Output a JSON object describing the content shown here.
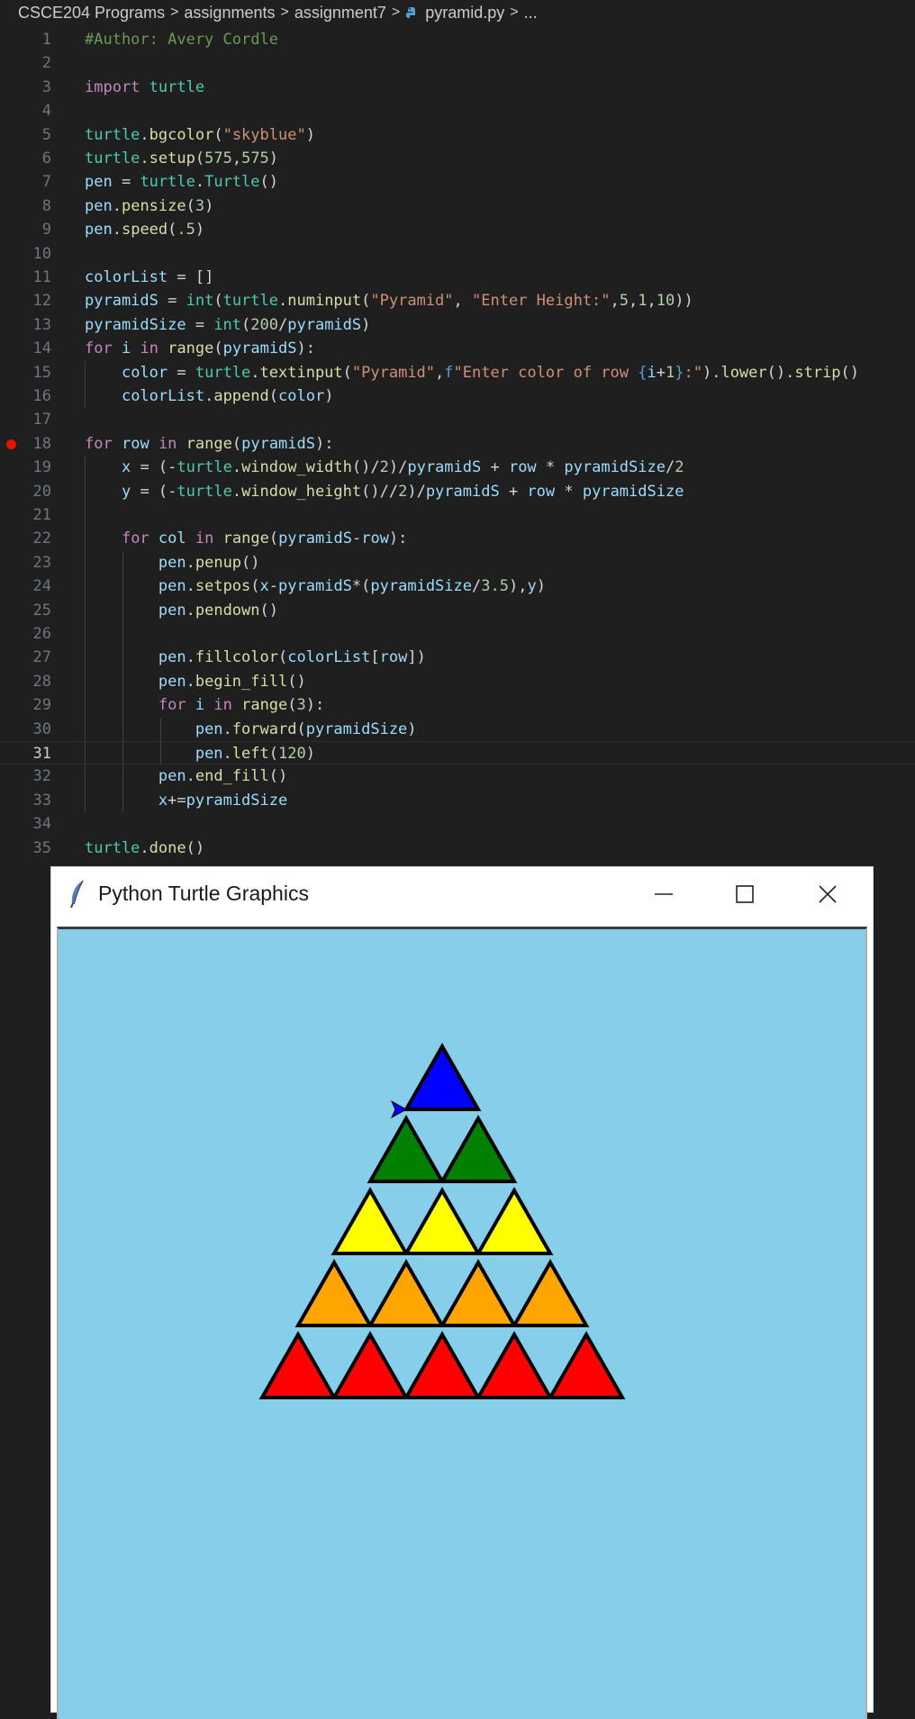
{
  "breadcrumb": {
    "items": [
      "CSCE204 Programs",
      "assignments",
      "assignment7",
      "pyramid.py",
      "..."
    ],
    "separator": ">"
  },
  "editor": {
    "current_line": 31,
    "breakpoint_line": 18,
    "lines": [
      {
        "n": "1",
        "tokens": [
          [
            "c",
            "#Author: Avery Cordle"
          ]
        ]
      },
      {
        "n": "2",
        "tokens": []
      },
      {
        "n": "3",
        "tokens": [
          [
            "k",
            "import"
          ],
          [
            "",
            " "
          ],
          [
            "b",
            "turtle"
          ]
        ]
      },
      {
        "n": "4",
        "tokens": []
      },
      {
        "n": "5",
        "tokens": [
          [
            "b",
            "turtle"
          ],
          [
            "",
            "."
          ],
          [
            "f",
            "bgcolor"
          ],
          [
            "",
            "("
          ],
          [
            "s",
            "\"skyblue\""
          ],
          [
            "",
            ")"
          ]
        ]
      },
      {
        "n": "6",
        "tokens": [
          [
            "b",
            "turtle"
          ],
          [
            "",
            "."
          ],
          [
            "f",
            "setup"
          ],
          [
            "",
            "("
          ],
          [
            "n",
            "575"
          ],
          [
            "",
            ","
          ],
          [
            "n",
            "575"
          ],
          [
            "",
            ")"
          ]
        ]
      },
      {
        "n": "7",
        "tokens": [
          [
            "v",
            "pen"
          ],
          [
            "",
            " = "
          ],
          [
            "b",
            "turtle"
          ],
          [
            "",
            "."
          ],
          [
            "b",
            "Turtle"
          ],
          [
            "",
            "()"
          ]
        ]
      },
      {
        "n": "8",
        "tokens": [
          [
            "v",
            "pen"
          ],
          [
            "",
            "."
          ],
          [
            "f",
            "pensize"
          ],
          [
            "",
            "("
          ],
          [
            "n",
            "3"
          ],
          [
            "",
            ")"
          ]
        ]
      },
      {
        "n": "9",
        "tokens": [
          [
            "v",
            "pen"
          ],
          [
            "",
            "."
          ],
          [
            "f",
            "speed"
          ],
          [
            "",
            "("
          ],
          [
            "n",
            ".5"
          ],
          [
            "",
            ")"
          ]
        ]
      },
      {
        "n": "10",
        "tokens": []
      },
      {
        "n": "11",
        "tokens": [
          [
            "v",
            "colorList"
          ],
          [
            "",
            " = []"
          ]
        ]
      },
      {
        "n": "12",
        "tokens": [
          [
            "v",
            "pyramidS"
          ],
          [
            "",
            " = "
          ],
          [
            "b",
            "int"
          ],
          [
            "",
            "("
          ],
          [
            "b",
            "turtle"
          ],
          [
            "",
            "."
          ],
          [
            "f",
            "numinput"
          ],
          [
            "",
            "("
          ],
          [
            "s",
            "\"Pyramid\""
          ],
          [
            "",
            ", "
          ],
          [
            "s",
            "\"Enter Height:\""
          ],
          [
            "",
            ","
          ],
          [
            "n",
            "5"
          ],
          [
            "",
            ","
          ],
          [
            "n",
            "1"
          ],
          [
            "",
            ","
          ],
          [
            "n",
            "10"
          ],
          [
            "",
            "))"
          ]
        ]
      },
      {
        "n": "13",
        "tokens": [
          [
            "v",
            "pyramidSize"
          ],
          [
            "",
            " = "
          ],
          [
            "b",
            "int"
          ],
          [
            "",
            "("
          ],
          [
            "n",
            "200"
          ],
          [
            "",
            "/"
          ],
          [
            "v",
            "pyramidS"
          ],
          [
            "",
            ")"
          ]
        ]
      },
      {
        "n": "14",
        "tokens": [
          [
            "k",
            "for"
          ],
          [
            "",
            " "
          ],
          [
            "v",
            "i"
          ],
          [
            "",
            " "
          ],
          [
            "k",
            "in"
          ],
          [
            "",
            " "
          ],
          [
            "f",
            "range"
          ],
          [
            "",
            "("
          ],
          [
            "v",
            "pyramidS"
          ],
          [
            "",
            "):"
          ]
        ]
      },
      {
        "n": "15",
        "tokens": [
          [
            "",
            "    "
          ],
          [
            "v",
            "color"
          ],
          [
            "",
            " = "
          ],
          [
            "b",
            "turtle"
          ],
          [
            "",
            "."
          ],
          [
            "f",
            "textinput"
          ],
          [
            "",
            "("
          ],
          [
            "s",
            "\"Pyramid\""
          ],
          [
            "",
            ","
          ],
          [
            "fs",
            "f"
          ],
          [
            "s",
            "\"Enter color of row "
          ],
          [
            "fs",
            "{"
          ],
          [
            "v",
            "i"
          ],
          [
            "",
            "+"
          ],
          [
            "n",
            "1"
          ],
          [
            "fs",
            "}"
          ],
          [
            "s",
            ":\""
          ],
          [
            "",
            ")."
          ],
          [
            "f",
            "lower"
          ],
          [
            "",
            "()."
          ],
          [
            "f",
            "strip"
          ],
          [
            "",
            "()"
          ]
        ]
      },
      {
        "n": "16",
        "tokens": [
          [
            "",
            "    "
          ],
          [
            "v",
            "colorList"
          ],
          [
            "",
            "."
          ],
          [
            "f",
            "append"
          ],
          [
            "",
            "("
          ],
          [
            "v",
            "color"
          ],
          [
            "",
            ")"
          ]
        ]
      },
      {
        "n": "17",
        "tokens": []
      },
      {
        "n": "18",
        "tokens": [
          [
            "k",
            "for"
          ],
          [
            "",
            " "
          ],
          [
            "v",
            "row"
          ],
          [
            "",
            " "
          ],
          [
            "k",
            "in"
          ],
          [
            "",
            " "
          ],
          [
            "f",
            "range"
          ],
          [
            "",
            "("
          ],
          [
            "v",
            "pyramidS"
          ],
          [
            "",
            "):"
          ]
        ]
      },
      {
        "n": "19",
        "tokens": [
          [
            "",
            "    "
          ],
          [
            "v",
            "x"
          ],
          [
            "",
            " = (-"
          ],
          [
            "b",
            "turtle"
          ],
          [
            "",
            "."
          ],
          [
            "f",
            "window_width"
          ],
          [
            "",
            "()/"
          ],
          [
            "n",
            "2"
          ],
          [
            "",
            ")/"
          ],
          [
            "v",
            "pyramidS"
          ],
          [
            "",
            " + "
          ],
          [
            "v",
            "row"
          ],
          [
            "",
            " * "
          ],
          [
            "v",
            "pyramidSize"
          ],
          [
            "",
            "/"
          ],
          [
            "n",
            "2"
          ]
        ]
      },
      {
        "n": "20",
        "tokens": [
          [
            "",
            "    "
          ],
          [
            "v",
            "y"
          ],
          [
            "",
            " = (-"
          ],
          [
            "b",
            "turtle"
          ],
          [
            "",
            "."
          ],
          [
            "f",
            "window_height"
          ],
          [
            "",
            "()//"
          ],
          [
            "n",
            "2"
          ],
          [
            "",
            ")/"
          ],
          [
            "v",
            "pyramidS"
          ],
          [
            "",
            " + "
          ],
          [
            "v",
            "row"
          ],
          [
            "",
            " * "
          ],
          [
            "v",
            "pyramidSize"
          ]
        ]
      },
      {
        "n": "21",
        "tokens": []
      },
      {
        "n": "22",
        "tokens": [
          [
            "",
            "    "
          ],
          [
            "k",
            "for"
          ],
          [
            "",
            " "
          ],
          [
            "v",
            "col"
          ],
          [
            "",
            " "
          ],
          [
            "k",
            "in"
          ],
          [
            "",
            " "
          ],
          [
            "f",
            "range"
          ],
          [
            "",
            "("
          ],
          [
            "v",
            "pyramidS"
          ],
          [
            "",
            "-"
          ],
          [
            "v",
            "row"
          ],
          [
            "",
            "):"
          ]
        ]
      },
      {
        "n": "23",
        "tokens": [
          [
            "",
            "        "
          ],
          [
            "v",
            "pen"
          ],
          [
            "",
            "."
          ],
          [
            "f",
            "penup"
          ],
          [
            "",
            "()"
          ]
        ]
      },
      {
        "n": "24",
        "tokens": [
          [
            "",
            "        "
          ],
          [
            "v",
            "pen"
          ],
          [
            "",
            "."
          ],
          [
            "f",
            "setpos"
          ],
          [
            "",
            "("
          ],
          [
            "v",
            "x"
          ],
          [
            "",
            "-"
          ],
          [
            "v",
            "pyramidS"
          ],
          [
            "",
            "*("
          ],
          [
            "v",
            "pyramidSize"
          ],
          [
            "",
            "/"
          ],
          [
            "n",
            "3.5"
          ],
          [
            "",
            "),"
          ],
          [
            "v",
            "y"
          ],
          [
            "",
            ")"
          ]
        ]
      },
      {
        "n": "25",
        "tokens": [
          [
            "",
            "        "
          ],
          [
            "v",
            "pen"
          ],
          [
            "",
            "."
          ],
          [
            "f",
            "pendown"
          ],
          [
            "",
            "()"
          ]
        ]
      },
      {
        "n": "26",
        "tokens": []
      },
      {
        "n": "27",
        "tokens": [
          [
            "",
            "        "
          ],
          [
            "v",
            "pen"
          ],
          [
            "",
            "."
          ],
          [
            "f",
            "fillcolor"
          ],
          [
            "",
            "("
          ],
          [
            "v",
            "colorList"
          ],
          [
            "",
            "["
          ],
          [
            "v",
            "row"
          ],
          [
            "",
            "])"
          ]
        ]
      },
      {
        "n": "28",
        "tokens": [
          [
            "",
            "        "
          ],
          [
            "v",
            "pen"
          ],
          [
            "",
            "."
          ],
          [
            "f",
            "begin_fill"
          ],
          [
            "",
            "()"
          ]
        ]
      },
      {
        "n": "29",
        "tokens": [
          [
            "",
            "        "
          ],
          [
            "k",
            "for"
          ],
          [
            "",
            " "
          ],
          [
            "v",
            "i"
          ],
          [
            "",
            " "
          ],
          [
            "k",
            "in"
          ],
          [
            "",
            " "
          ],
          [
            "f",
            "range"
          ],
          [
            "",
            "("
          ],
          [
            "n",
            "3"
          ],
          [
            "",
            "):"
          ]
        ]
      },
      {
        "n": "30",
        "tokens": [
          [
            "",
            "            "
          ],
          [
            "v",
            "pen"
          ],
          [
            "",
            "."
          ],
          [
            "f",
            "forward"
          ],
          [
            "",
            "("
          ],
          [
            "v",
            "pyramidSize"
          ],
          [
            "",
            ")"
          ]
        ]
      },
      {
        "n": "31",
        "tokens": [
          [
            "",
            "            "
          ],
          [
            "v",
            "pen"
          ],
          [
            "",
            "."
          ],
          [
            "f",
            "left"
          ],
          [
            "",
            "("
          ],
          [
            "n",
            "120"
          ],
          [
            "",
            ")"
          ]
        ]
      },
      {
        "n": "32",
        "tokens": [
          [
            "",
            "        "
          ],
          [
            "v",
            "pen"
          ],
          [
            "",
            "."
          ],
          [
            "f",
            "end_fill"
          ],
          [
            "",
            "()"
          ]
        ]
      },
      {
        "n": "33",
        "tokens": [
          [
            "",
            "        "
          ],
          [
            "v",
            "x"
          ],
          [
            "",
            "+="
          ],
          [
            "v",
            "pyramidSize"
          ]
        ]
      },
      {
        "n": "34",
        "tokens": []
      },
      {
        "n": "35",
        "tokens": [
          [
            "b",
            "turtle"
          ],
          [
            "",
            "."
          ],
          [
            "f",
            "done"
          ],
          [
            "",
            "()"
          ]
        ]
      }
    ]
  },
  "turtle_window": {
    "title": "Python Turtle Graphics",
    "background_color": "#87ceeb",
    "pyramid": {
      "rows_bottom_to_top": [
        {
          "color": "#ff0000",
          "count": 5
        },
        {
          "color": "#ffa500",
          "count": 4
        },
        {
          "color": "#ffff00",
          "count": 3
        },
        {
          "color": "#008000",
          "count": 2
        },
        {
          "color": "#0000ff",
          "count": 1
        }
      ],
      "outline_color": "#000000"
    },
    "turtle_cursor_color": "#0000ff"
  }
}
